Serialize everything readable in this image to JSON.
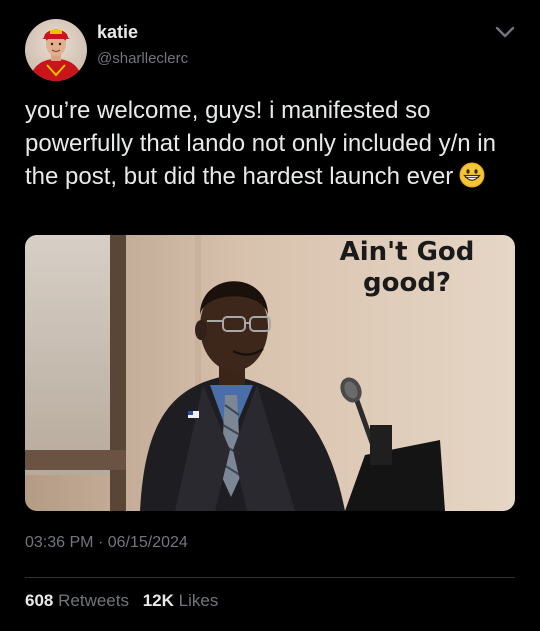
{
  "author": {
    "display_name": "katie",
    "handle": "@sharlleclerc",
    "avatar_icon": "profile-avatar"
  },
  "tweet": {
    "text": "you’re welcome, guys! i manifested so powerfully that lando not only included y/n in the post, but did the hardest launch ever",
    "emoji_icon": "grinning-face-emoji",
    "media": {
      "caption": "Ain't God good?"
    },
    "time": "03:36 PM",
    "separator": "·",
    "date": "06/15/2024"
  },
  "stats": {
    "retweets_count": "608",
    "retweets_label": "Retweets",
    "likes_count": "12K",
    "likes_label": "Likes"
  },
  "colors": {
    "background": "#000000",
    "primary_text": "#e7e9ea",
    "secondary_text": "#71767b",
    "divider": "#2f3336"
  }
}
